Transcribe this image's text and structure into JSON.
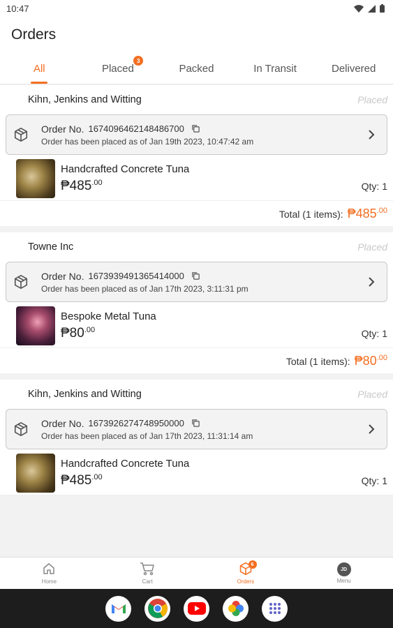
{
  "status_bar": {
    "time": "10:47"
  },
  "header": {
    "title": "Orders"
  },
  "tabs": [
    {
      "label": "All",
      "active": true
    },
    {
      "label": "Placed",
      "badge": "3"
    },
    {
      "label": "Packed"
    },
    {
      "label": "In Transit"
    },
    {
      "label": "Delivered"
    }
  ],
  "orders": [
    {
      "store": "Kihn, Jenkins and Witting",
      "status": "Placed",
      "order_no_label": "Order No.",
      "order_no": "1674096462148486700",
      "placed_text": "Order has been placed as of Jan 19th 2023, 10:47:42 am",
      "item": {
        "name": "Handcrafted Concrete Tuna",
        "price": "₱485",
        "price_cents": ".00",
        "qty": "Qty: 1"
      },
      "total_label": "Total (1 items):",
      "total": "₱485",
      "total_cents": ".00"
    },
    {
      "store": "Towne Inc",
      "status": "Placed",
      "order_no_label": "Order No.",
      "order_no": "1673939491365414000",
      "placed_text": "Order has been placed as of Jan 17th 2023, 3:11:31 pm",
      "item": {
        "name": "Bespoke Metal Tuna",
        "price": "₱80",
        "price_cents": ".00",
        "qty": "Qty: 1"
      },
      "total_label": "Total (1 items):",
      "total": "₱80",
      "total_cents": ".00"
    },
    {
      "store": "Kihn, Jenkins and Witting",
      "status": "Placed",
      "order_no_label": "Order No.",
      "order_no": "1673926274748950000",
      "placed_text": "Order has been placed as of Jan 17th 2023, 11:31:14 am",
      "item": {
        "name": "Handcrafted Concrete Tuna",
        "price": "₱485",
        "price_cents": ".00",
        "qty": "Qty: 1"
      }
    }
  ],
  "bottom_nav": [
    {
      "label": "Home",
      "icon": "home-icon"
    },
    {
      "label": "Cart",
      "icon": "cart-icon"
    },
    {
      "label": "Orders",
      "icon": "box-icon",
      "active": true,
      "badge": "6"
    },
    {
      "label": "Menu",
      "icon": "avatar",
      "avatar_initials": "JD"
    }
  ],
  "dock": [
    "gmail-icon",
    "chrome-icon",
    "youtube-icon",
    "photos-icon",
    "app-drawer-icon"
  ],
  "colors": {
    "accent": "#f36f21",
    "status_muted": "#c8c8c8",
    "dock_bg": "#1d1d1d"
  }
}
